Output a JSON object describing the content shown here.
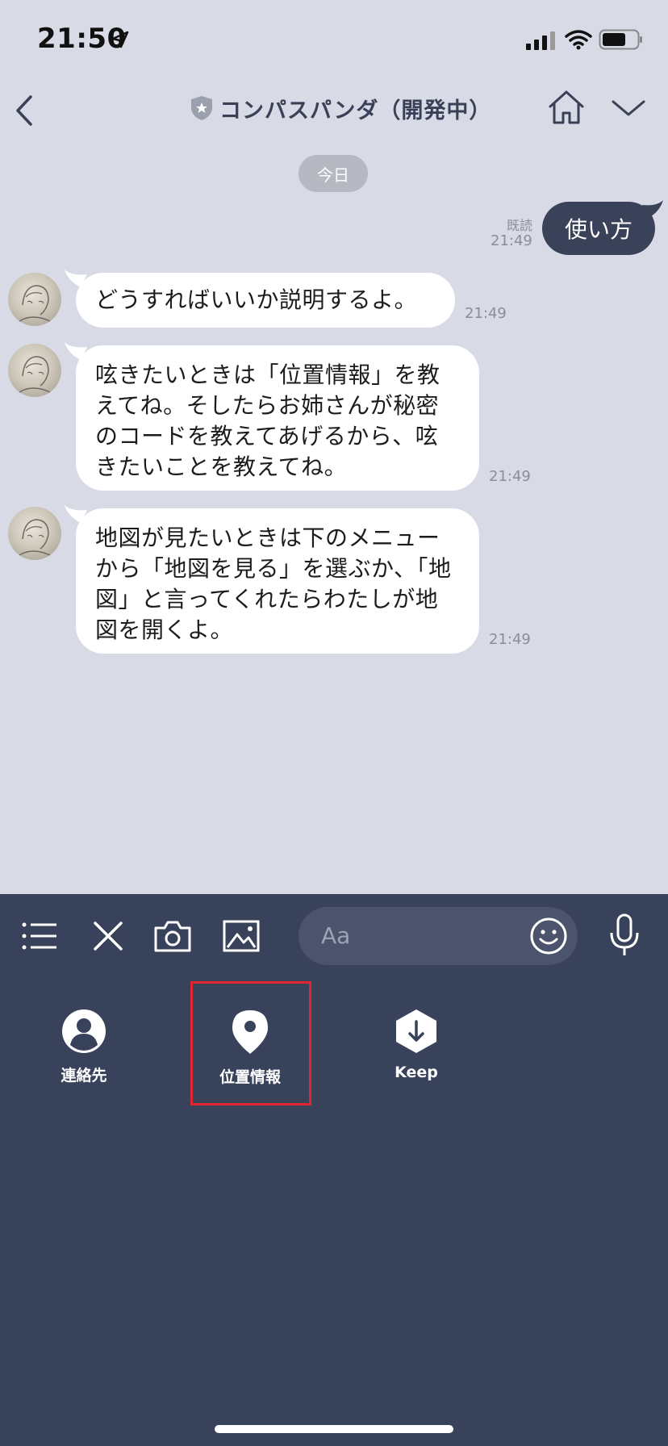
{
  "status_bar": {
    "time": "21:50"
  },
  "header": {
    "title": "コンパスパンダ（開発中）"
  },
  "date_divider": "今日",
  "messages": {
    "sent": {
      "text": "使い方",
      "read_label": "既読",
      "time": "21:49"
    },
    "received": [
      {
        "text": "どうすればいいか説明するよ。",
        "time": "21:49"
      },
      {
        "text": "呟きたいときは「位置情報」を教えてね。そしたらお姉さんが秘密のコードを教えてあげるから、呟きたいことを教えてね。",
        "time": "21:49"
      },
      {
        "text": "地図が見たいときは下のメニューから「地図を見る」を選ぶか、「地図」と言ってくれたらわたしが地図を開くよ。",
        "time": "21:49"
      }
    ]
  },
  "input": {
    "placeholder": "Aa"
  },
  "actions": [
    {
      "label": "連絡先",
      "icon": "person-icon"
    },
    {
      "label": "位置情報",
      "icon": "location-pin-icon"
    },
    {
      "label": "Keep",
      "icon": "keep-download-icon"
    }
  ],
  "colors": {
    "chat_background": "#d8dbe6",
    "panel_background": "#39425b",
    "sent_bubble": "#3a4259",
    "highlight": "#e0262c"
  }
}
